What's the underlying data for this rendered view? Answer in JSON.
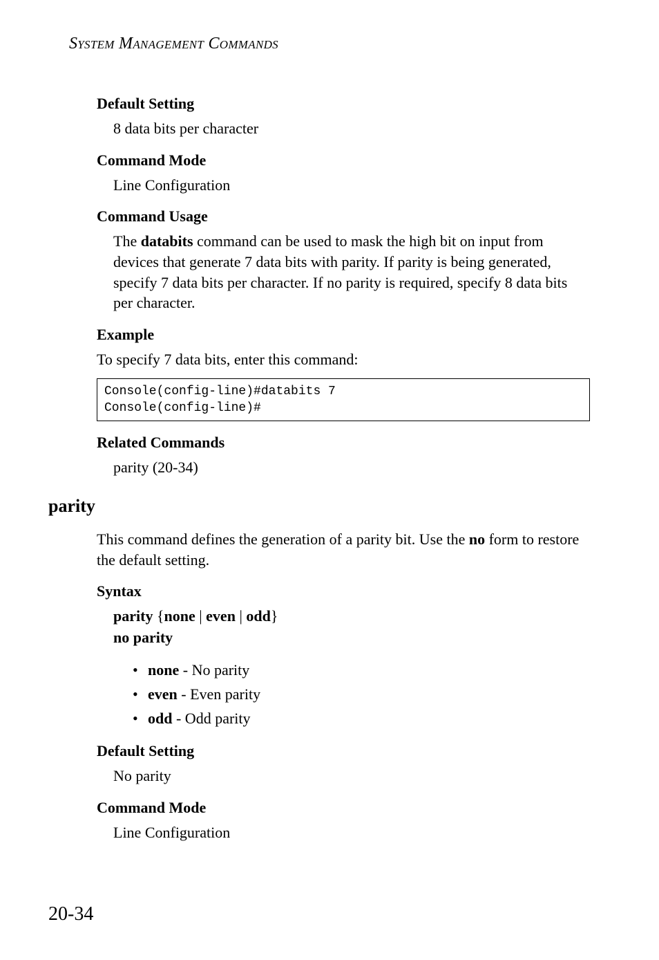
{
  "running_header": "System Management Commands",
  "sections": {
    "default_setting_1": {
      "heading": "Default Setting",
      "text": "8 data bits per character"
    },
    "command_mode_1": {
      "heading": "Command Mode",
      "text": "Line Configuration"
    },
    "command_usage": {
      "heading": "Command Usage",
      "prefix": "The ",
      "keyword": "databits",
      "rest": " command can be used to mask the high bit on input from devices that generate 7 data bits with parity. If parity is being generated, specify 7 data bits per character. If no parity is required, specify 8 data bits per character."
    },
    "example": {
      "heading": "Example",
      "intro": "To specify 7 data bits, enter this command:",
      "code": "Console(config-line)#databits 7\nConsole(config-line)#"
    },
    "related_commands": {
      "heading": "Related Commands",
      "text": "parity (20-34)"
    },
    "parity": {
      "heading": "parity",
      "intro_pre": "This command defines the generation of a parity bit. Use the ",
      "intro_bold": "no",
      "intro_post": " form to restore the default setting."
    },
    "syntax": {
      "heading": "Syntax",
      "line1_bold1": "parity",
      "line1_brace_open": " {",
      "line1_opt1": "none",
      "line1_sep1": " | ",
      "line1_opt2": "even",
      "line1_sep2": " | ",
      "line1_opt3": "odd",
      "line1_brace_close": "}",
      "line2": "no parity",
      "opts": {
        "none": {
          "bold": "none",
          "text": " - No parity"
        },
        "even": {
          "bold": "even",
          "text": " - Even parity"
        },
        "odd": {
          "bold": "odd",
          "text": " - Odd parity"
        }
      }
    },
    "default_setting_2": {
      "heading": "Default Setting",
      "text": "No parity"
    },
    "command_mode_2": {
      "heading": "Command Mode",
      "text": "Line Configuration"
    }
  },
  "page_number": "20-34"
}
